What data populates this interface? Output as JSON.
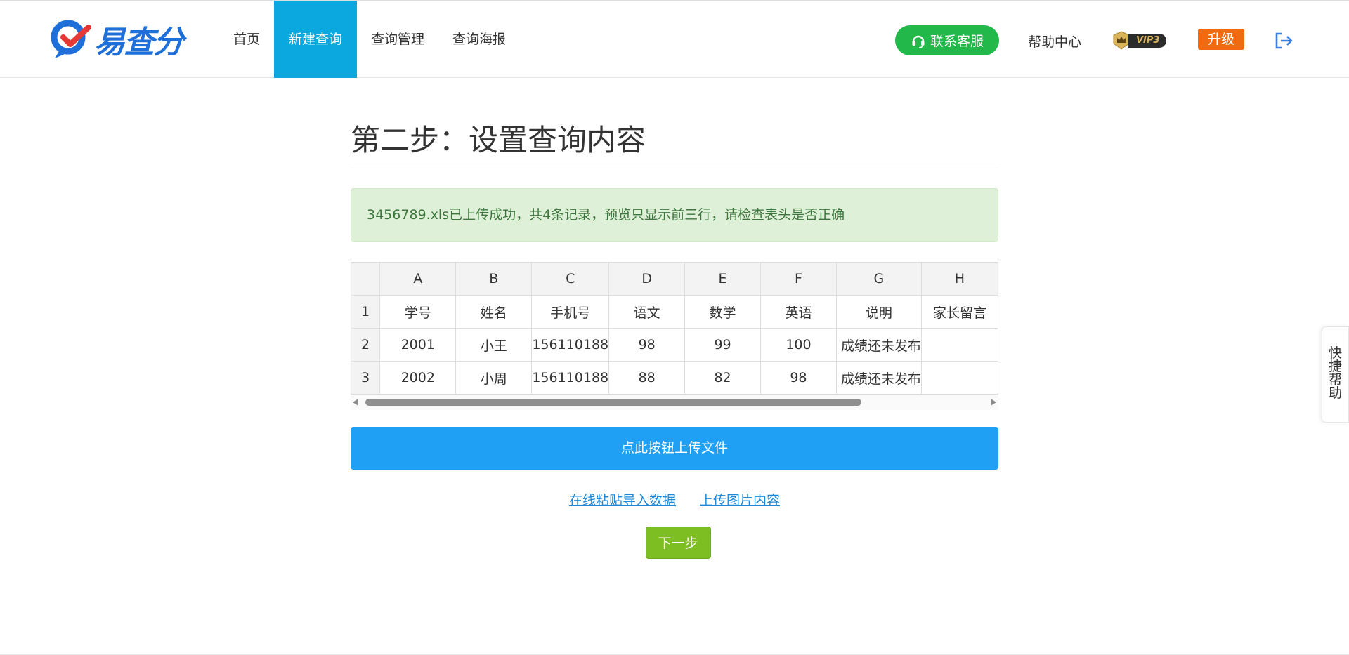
{
  "header": {
    "logo_text": "易查分",
    "nav": [
      {
        "label": "首页",
        "active": false
      },
      {
        "label": "新建查询",
        "active": true
      },
      {
        "label": "查询管理",
        "active": false
      },
      {
        "label": "查询海报",
        "active": false
      }
    ],
    "service_label": "联系客服",
    "help_label": "帮助中心",
    "vip_label": "VIP3",
    "upgrade_label": "升级",
    "colors": {
      "accent": "#0aa8de",
      "service": "#23b84a",
      "upgrade": "#f06a12"
    }
  },
  "main": {
    "title": "第二步：设置查询内容",
    "alert": "3456789.xls已上传成功，共4条记录，预览只显示前三行，请检查表头是否正确",
    "table": {
      "columns": [
        "A",
        "B",
        "C",
        "D",
        "E",
        "F",
        "G",
        "H"
      ],
      "rows": [
        {
          "num": "1",
          "cells": [
            "学号",
            "姓名",
            "手机号",
            "语文",
            "数学",
            "英语",
            "说明",
            "家长留言"
          ]
        },
        {
          "num": "2",
          "cells": [
            "2001",
            "小王",
            "156110188",
            "98",
            "99",
            "100",
            "成绩还未发布",
            ""
          ]
        },
        {
          "num": "3",
          "cells": [
            "2002",
            "小周",
            "156110188",
            "88",
            "82",
            "98",
            "成绩还未发布",
            ""
          ]
        }
      ]
    },
    "upload_button": "点此按钮上传文件",
    "links": [
      "在线粘贴导入数据",
      "上传图片内容"
    ],
    "next_button": "下一步"
  },
  "quick_help": "快捷帮助"
}
